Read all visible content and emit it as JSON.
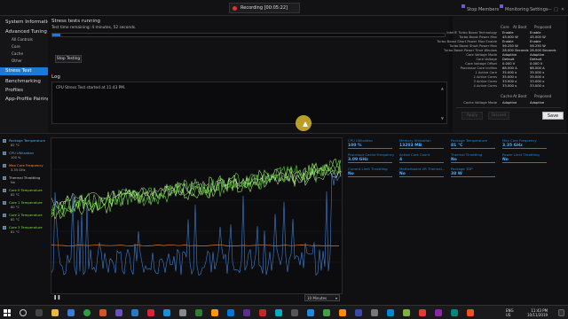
{
  "topbar": {
    "recording_label": "Recording [00:05:22]",
    "stop_members": "Stop Members",
    "monitoring": "Monitoring",
    "settings": "Settings",
    "window_buttons": [
      "—",
      "□",
      "✕"
    ]
  },
  "sidebar": {
    "items": [
      {
        "label": "System Information",
        "sub": false,
        "active": false
      },
      {
        "label": "Advanced Tuning",
        "sub": false,
        "active": false
      },
      {
        "label": "All Controls",
        "sub": true,
        "active": false
      },
      {
        "label": "Core",
        "sub": true,
        "active": false
      },
      {
        "label": "Cache",
        "sub": true,
        "active": false
      },
      {
        "label": "Other",
        "sub": true,
        "active": false
      },
      {
        "label": "Stress Test",
        "sub": false,
        "active": true
      },
      {
        "label": "Benchmarking",
        "sub": false,
        "active": false
      },
      {
        "label": "Profiles",
        "sub": false,
        "active": false
      },
      {
        "label": "App-Profile Pairing",
        "sub": false,
        "active": false
      }
    ]
  },
  "stress": {
    "title": "Stress tests running",
    "time_remaining": "Test time remaining: 4 minutes, 52 seconds.",
    "progress": 0.02,
    "stop_button": "Stop Testing",
    "log_title": "Log",
    "log_line": "CPU Stress Test started at 11:43 PM."
  },
  "right_panel": {
    "headers": {
      "core": "Core",
      "at_boot": "At Boot",
      "proposed": "Proposed"
    },
    "rows": [
      {
        "label": "Intel® Turbo Boost Technology",
        "boot": "Enable",
        "proposed": "Enable"
      },
      {
        "label": "Turbo Boost Power Max",
        "boot": "45.000 W",
        "proposed": "45.000 W"
      },
      {
        "label": "Turbo Boost Short Power Max Enable",
        "boot": "Enable",
        "proposed": "Enable"
      },
      {
        "label": "Turbo Boost Short Power Max",
        "boot": "56.250 W",
        "proposed": "56.250 W"
      },
      {
        "label": "Turbo Boost Power Time Window",
        "boot": "28.000 Seconds",
        "proposed": "28.000 Seconds"
      },
      {
        "label": "Core Voltage Mode",
        "boot": "Adaptive",
        "proposed": "Adaptive"
      },
      {
        "label": "Core Voltage",
        "boot": "Default",
        "proposed": "Default"
      },
      {
        "label": "Core Voltage Offset",
        "boot": "0.000 V",
        "proposed": "0.000 V"
      },
      {
        "label": "Processor Core IccMax",
        "boot": "68.000 A",
        "proposed": "68.000 A"
      },
      {
        "label": "1 Active Core",
        "boot": "35.000 x",
        "proposed": "35.000 x"
      },
      {
        "label": "2 Active Cores",
        "boot": "35.000 x",
        "proposed": "35.000 x"
      },
      {
        "label": "3 Active Cores",
        "boot": "33.000 x",
        "proposed": "33.000 x"
      },
      {
        "label": "4 Active Cores",
        "boot": "33.000 x",
        "proposed": "33.000 x"
      }
    ],
    "cache_headers": {
      "cache": "Cache",
      "at_boot": "At Boot",
      "proposed": "Proposed"
    },
    "cache_row": {
      "label": "Cache Voltage Mode",
      "boot": "Adaptive",
      "proposed": "Adaptive"
    },
    "apply": "Apply",
    "discard": "Discard",
    "save": "Save"
  },
  "legend": [
    {
      "name": "Package Temperature",
      "value": "82 °C",
      "color": "#4ab0ff"
    },
    {
      "name": "CPU Utilization",
      "value": "100 %",
      "color": "#4ab0ff"
    },
    {
      "name": "Max Core Frequency",
      "value": "3.35 GHz",
      "color": "#ff8c3a"
    },
    {
      "name": "Thermal Throttling",
      "value": "No",
      "color": "#cfcfcf"
    },
    {
      "name": "Core 0 Temperature",
      "value": "82 °C",
      "color": "#7ddf4a"
    },
    {
      "name": "Core 1 Temperature",
      "value": "80 °C",
      "color": "#7ddf4a"
    },
    {
      "name": "Core 2 Temperature",
      "value": "82 °C",
      "color": "#7ddf4a"
    },
    {
      "name": "Core 3 Temperature",
      "value": "81 °C",
      "color": "#7ddf4a"
    }
  ],
  "graph": {
    "range_select": "10 Minutes"
  },
  "tiles": [
    {
      "label": "CPU Utilization",
      "value": "100 %"
    },
    {
      "label": "Memory Utilization",
      "value": "13203 MB"
    },
    {
      "label": "Package Temperature",
      "value": "81 °C"
    },
    {
      "label": "Max Core Frequency",
      "value": "3.35 GHz"
    },
    {
      "label": "Processor Cache Frequency",
      "value": "3.09 GHz"
    },
    {
      "label": "Active Core Count",
      "value": "4"
    },
    {
      "label": "Thermal Throttling",
      "value": "No"
    },
    {
      "label": "Power Limit Throttling",
      "value": "No"
    },
    {
      "label": "Current Limit Throttling",
      "value": "No"
    },
    {
      "label": "Motherboard VR Thermal...",
      "value": "No"
    },
    {
      "label": "Package TDP",
      "value": "38 W"
    }
  ],
  "taskbar": {
    "lang": "ENG",
    "region": "US",
    "time": "11:43 PM",
    "date": "10/11/2019"
  }
}
